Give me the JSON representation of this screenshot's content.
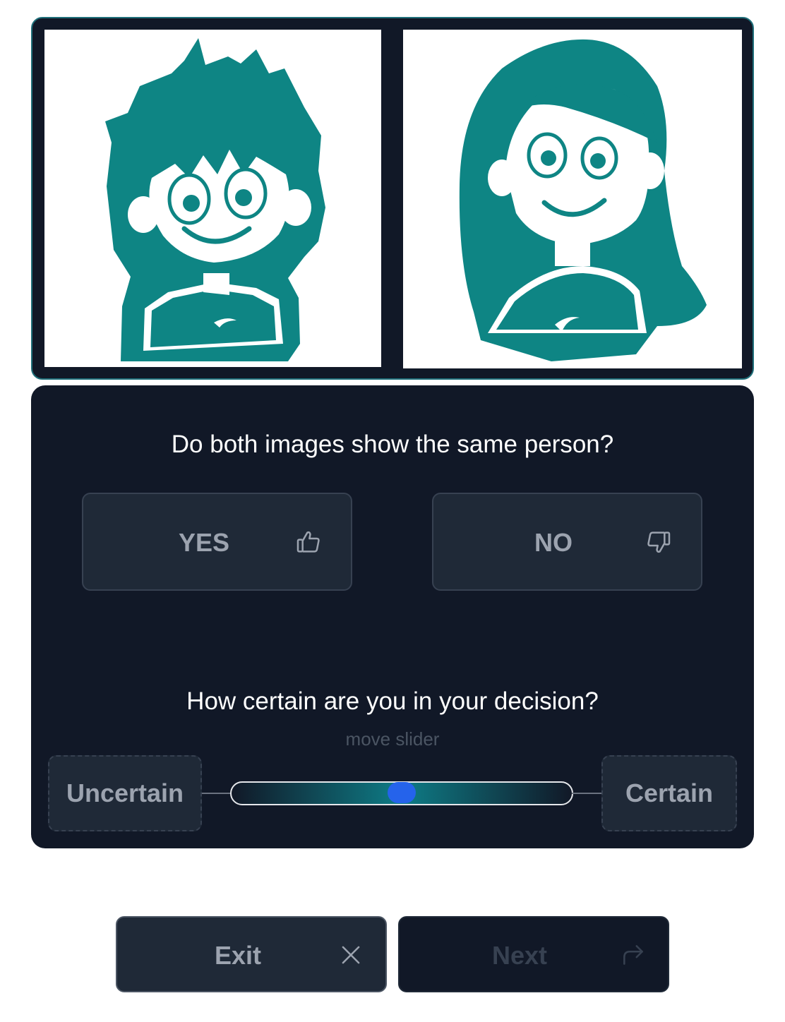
{
  "colors": {
    "panel_bg": "#111827",
    "button_bg": "#1f2937",
    "accent_teal": "#008080",
    "slider_thumb": "#2563eb"
  },
  "images": {
    "left": {
      "icon": "cartoon-boy-portrait"
    },
    "right": {
      "icon": "cartoon-girl-portrait"
    }
  },
  "question": {
    "title": "Do both images show the same person?",
    "yes_label": "YES",
    "yes_icon": "thumbs-up-icon",
    "no_label": "NO",
    "no_icon": "thumbs-down-icon"
  },
  "certainty": {
    "title": "How certain are you in your decision?",
    "hint": "move slider",
    "min_label": "Uncertain",
    "max_label": "Certain",
    "value": 0.5
  },
  "actions": {
    "exit_label": "Exit",
    "exit_icon": "close-icon",
    "next_label": "Next",
    "next_icon": "redo-arrow-icon"
  }
}
